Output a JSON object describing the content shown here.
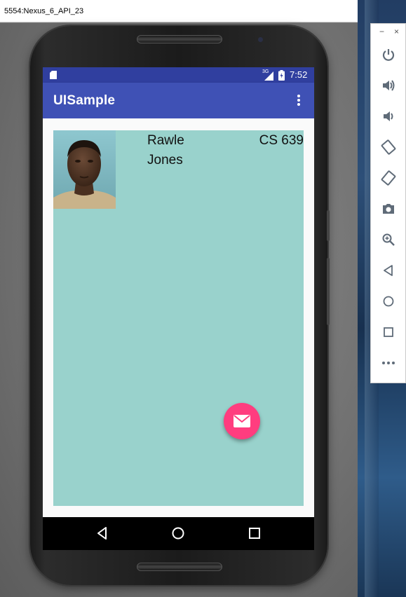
{
  "window": {
    "title": "5554:Nexus_6_API_23"
  },
  "status_bar": {
    "network_label": "3G",
    "time": "7:52",
    "icons": [
      "sd-card-icon",
      "signal-icon",
      "battery-icon"
    ]
  },
  "app": {
    "title": "UISample",
    "menu_icon": "overflow-menu-icon"
  },
  "profile": {
    "first_name": "Rawle",
    "last_name": "Jones",
    "course": "CS 639"
  },
  "fab": {
    "icon": "email-icon"
  },
  "nav_bar": {
    "icons": [
      "back-icon",
      "home-icon",
      "recents-icon"
    ]
  },
  "controls": {
    "minimize": "−",
    "close": "×",
    "icons": [
      "power-icon",
      "volume-up-icon",
      "volume-down-icon",
      "rotate-left-icon",
      "rotate-right-icon",
      "camera-icon",
      "zoom-icon",
      "back-icon",
      "home-icon",
      "overview-icon",
      "more-icon"
    ]
  },
  "colors": {
    "status_bar": "#303f9f",
    "toolbar": "#3f51b5",
    "card": "#99d2cc",
    "fab": "#ff3d7f",
    "controls_icon": "#5f6b78"
  }
}
